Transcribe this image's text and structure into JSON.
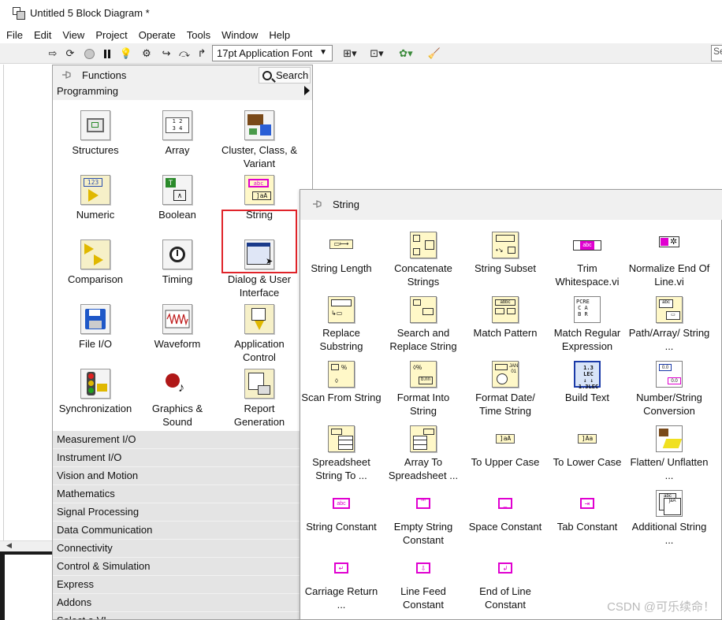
{
  "window": {
    "title": "Untitled 5 Block Diagram *"
  },
  "menu": [
    "File",
    "Edit",
    "View",
    "Project",
    "Operate",
    "Tools",
    "Window",
    "Help"
  ],
  "toolbar": {
    "font": "17pt Application Font",
    "search_stub": "Se"
  },
  "functions": {
    "title": "Functions",
    "search_label": "Search",
    "category": "Programming",
    "items": [
      {
        "label": "Structures"
      },
      {
        "label": "Array"
      },
      {
        "label": "Cluster, Class, & Variant"
      },
      {
        "label": "Numeric"
      },
      {
        "label": "Boolean"
      },
      {
        "label": "String"
      },
      {
        "label": "Comparison"
      },
      {
        "label": "Timing"
      },
      {
        "label": "Dialog & User Interface"
      },
      {
        "label": "File I/O"
      },
      {
        "label": "Waveform"
      },
      {
        "label": "Application Control"
      },
      {
        "label": "Synchronization"
      },
      {
        "label": "Graphics & Sound"
      },
      {
        "label": "Report Generation"
      }
    ],
    "categories": [
      "Measurement I/O",
      "Instrument I/O",
      "Vision and Motion",
      "Mathematics",
      "Signal Processing",
      "Data Communication",
      "Connectivity",
      "Control & Simulation",
      "Express",
      "Addons",
      "Select a VI..."
    ]
  },
  "string_palette": {
    "title": "String",
    "items": [
      {
        "label": "String Length"
      },
      {
        "label": "Concatenate Strings"
      },
      {
        "label": "String Subset"
      },
      {
        "label": "Trim Whitespace.vi"
      },
      {
        "label": "Normalize End Of Line.vi"
      },
      {
        "label": "Replace Substring"
      },
      {
        "label": "Search and Replace String"
      },
      {
        "label": "Match Pattern"
      },
      {
        "label": "Match Regular Expression"
      },
      {
        "label": "Path/Array/ String ..."
      },
      {
        "label": "Scan From String"
      },
      {
        "label": "Format Into String"
      },
      {
        "label": "Format Date/ Time String"
      },
      {
        "label": "Build Text"
      },
      {
        "label": "Number/String Conversion"
      },
      {
        "label": "Spreadsheet String To ..."
      },
      {
        "label": "Array To Spreadsheet ..."
      },
      {
        "label": "To Upper Case"
      },
      {
        "label": "To Lower Case"
      },
      {
        "label": "Flatten/ Unflatten ..."
      },
      {
        "label": "String Constant"
      },
      {
        "label": "Empty String Constant"
      },
      {
        "label": "Space Constant"
      },
      {
        "label": "Tab Constant"
      },
      {
        "label": "Additional String ..."
      },
      {
        "label": "Carriage Return ..."
      },
      {
        "label": "Line Feed Constant"
      },
      {
        "label": "End of Line Constant"
      }
    ]
  },
  "watermark": "CSDN @可乐续命！",
  "colors": {
    "highlight": "#e0242a",
    "string_pink": "#e000d0",
    "icon_yellow": "#fff8c8"
  }
}
